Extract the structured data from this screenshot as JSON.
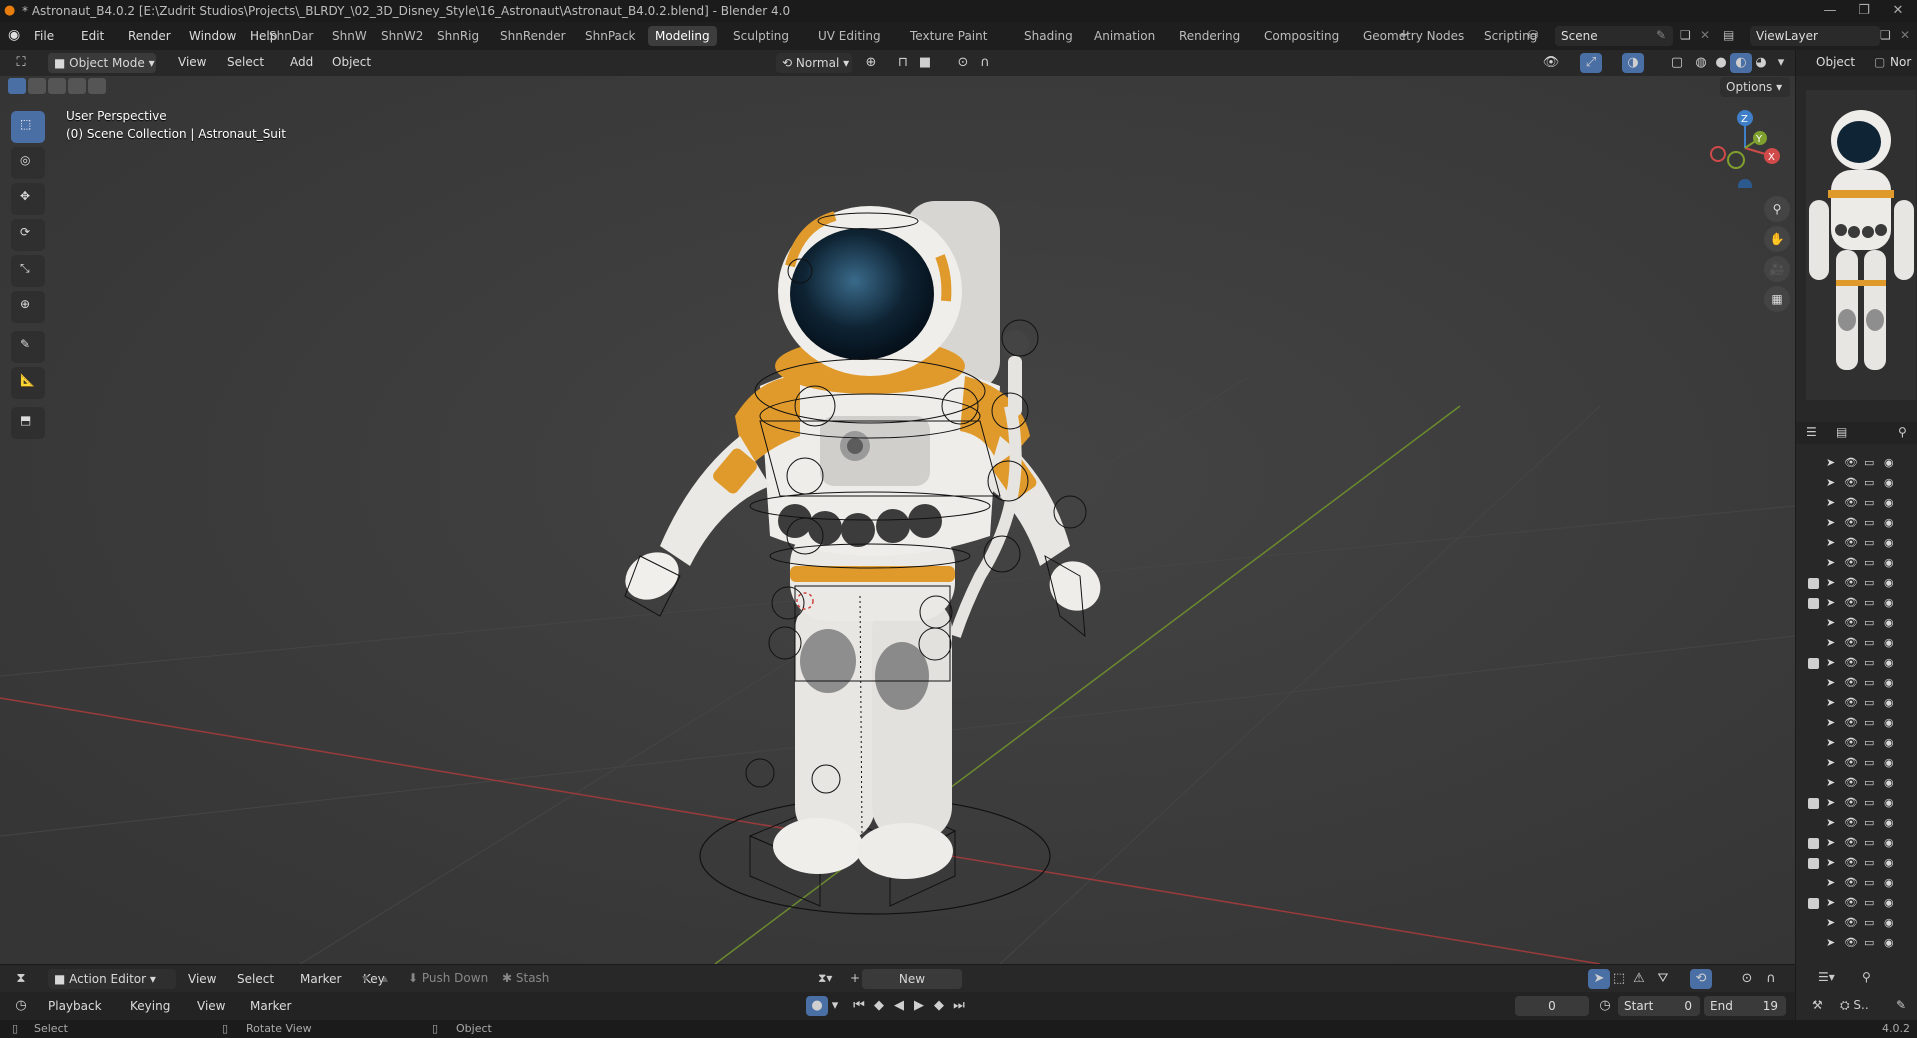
{
  "title": "* Astronaut_B4.0.2 [E:\\Zudrit Studios\\Projects\\_BLRDY_\\02_3D_Disney_Style\\16_Astronaut\\Astronaut_B4.0.2.blend] - Blender 4.0",
  "main_menu": [
    "File",
    "Edit",
    "Render",
    "Window",
    "Help"
  ],
  "workspaces": [
    "ShnDar",
    "ShnW",
    "ShnW2",
    "ShnRig",
    "ShnRender",
    "ShnPack",
    "Modeling",
    "Sculpting",
    "UV Editing",
    "Texture Paint",
    "Shading",
    "Animation",
    "Rendering",
    "Compositing",
    "Geometry Nodes",
    "Scripting"
  ],
  "active_workspace": "Modeling",
  "scene_name": "Scene",
  "view_layer": "ViewLayer",
  "viewport_header": {
    "mode": "Object Mode",
    "menus": [
      "View",
      "Select",
      "Add",
      "Object"
    ],
    "orientation": "Normal",
    "options_label": "Options"
  },
  "viewport": {
    "view_name": "User Perspective",
    "collection_info": "(0) Scene Collection | Astronaut_Suit"
  },
  "gizmo": {
    "x": "X",
    "y": "Y",
    "z": "Z"
  },
  "right_panel": {
    "tabs": [
      "Object",
      "Nor"
    ],
    "outliner_rows": [
      {
        "checkbox": false,
        "visible": true
      },
      {
        "checkbox": false,
        "visible": true
      },
      {
        "checkbox": false,
        "visible": true
      },
      {
        "checkbox": false,
        "visible": true
      },
      {
        "checkbox": false,
        "visible": true
      },
      {
        "checkbox": false,
        "visible": true
      },
      {
        "checkbox": true,
        "visible": true
      },
      {
        "checkbox": true,
        "visible": true
      },
      {
        "checkbox": false,
        "visible": true
      },
      {
        "checkbox": false,
        "visible": true
      },
      {
        "checkbox": true,
        "visible": true
      },
      {
        "checkbox": false,
        "visible": true
      },
      {
        "checkbox": false,
        "visible": true
      },
      {
        "checkbox": false,
        "visible": true
      },
      {
        "checkbox": false,
        "visible": true
      },
      {
        "checkbox": false,
        "visible": true
      },
      {
        "checkbox": false,
        "visible": true
      },
      {
        "checkbox": true,
        "visible": true
      },
      {
        "checkbox": false,
        "visible": true
      },
      {
        "checkbox": true,
        "visible": true
      },
      {
        "checkbox": true,
        "visible": true
      },
      {
        "checkbox": false,
        "visible": true
      },
      {
        "checkbox": true,
        "visible": true
      },
      {
        "checkbox": false,
        "visible": true
      },
      {
        "checkbox": false,
        "visible": true
      }
    ]
  },
  "action_editor": {
    "editor": "Action Editor",
    "menus": [
      "View",
      "Select",
      "Marker",
      "Key"
    ],
    "push_down": "Push Down",
    "stash": "Stash",
    "new_label": "New"
  },
  "timeline": {
    "menus": [
      "Playback",
      "Keying",
      "View",
      "Marker"
    ],
    "current_frame": "0",
    "start_label": "Start",
    "start_value": "0",
    "end_label": "End",
    "end_value": "19"
  },
  "statusbar": {
    "select": "Select",
    "rotate": "Rotate View",
    "object": "Object",
    "version": "4.0.2"
  }
}
